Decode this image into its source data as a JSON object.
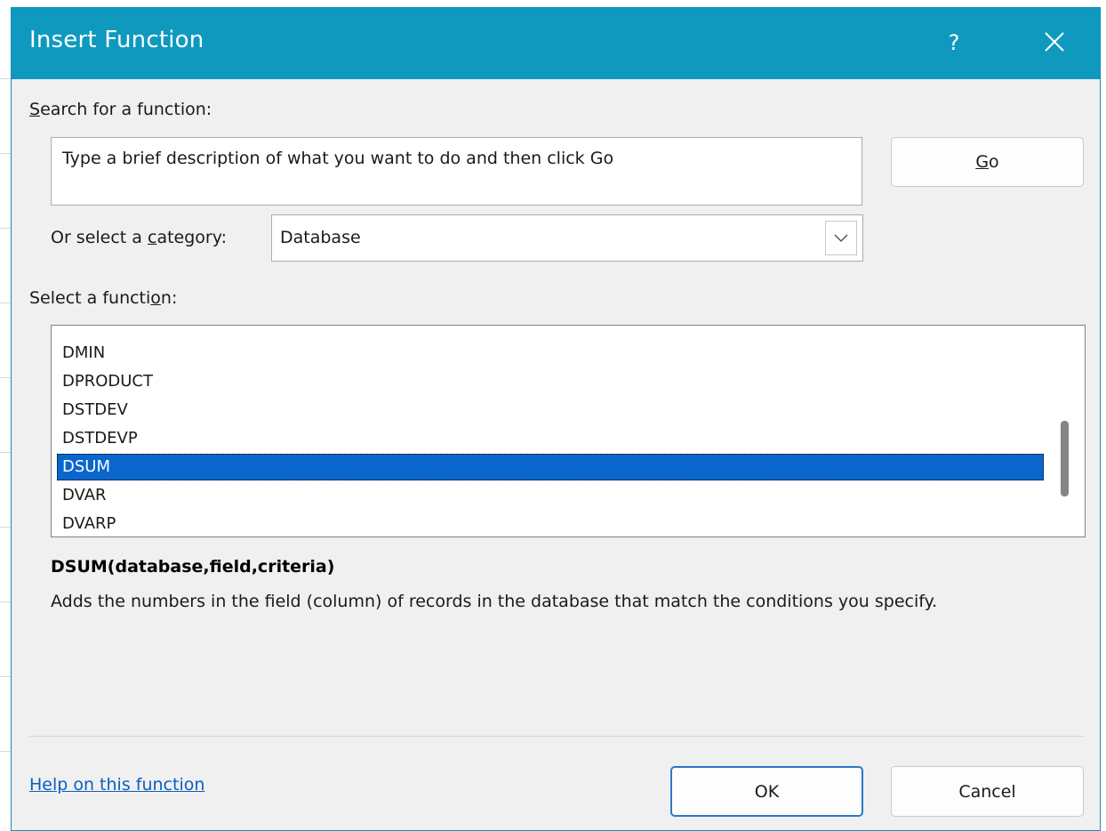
{
  "dialog": {
    "title": "Insert Function",
    "help_symbol": "?",
    "close_icon": "close-icon"
  },
  "search": {
    "label_pre": "",
    "label_mnemonic": "S",
    "label_post": "earch for a function:",
    "value": "Type a brief description of what you want to do and then click Go",
    "go_pre": "",
    "go_mnemonic": "G",
    "go_post": "o"
  },
  "category": {
    "label_pre": "Or select a ",
    "label_mnemonic": "c",
    "label_post": "ategory:",
    "selected": "Database"
  },
  "function_list": {
    "label_pre": "Select a functi",
    "label_mnemonic": "o",
    "label_post": "n:",
    "items": [
      "DMIN",
      "DPRODUCT",
      "DSTDEV",
      "DSTDEVP",
      "DSUM",
      "DVAR",
      "DVARP"
    ],
    "selected_index": 4
  },
  "details": {
    "signature": "DSUM(database,field,criteria)",
    "description": "Adds the numbers in the field (column) of records in the database that match the conditions you specify."
  },
  "footer": {
    "help_link": "Help on this function",
    "ok_label": "OK",
    "cancel_label": "Cancel"
  },
  "colors": {
    "title_bar": "#0f99bf",
    "selection": "#0a66cc",
    "link": "#0a5fc0"
  }
}
